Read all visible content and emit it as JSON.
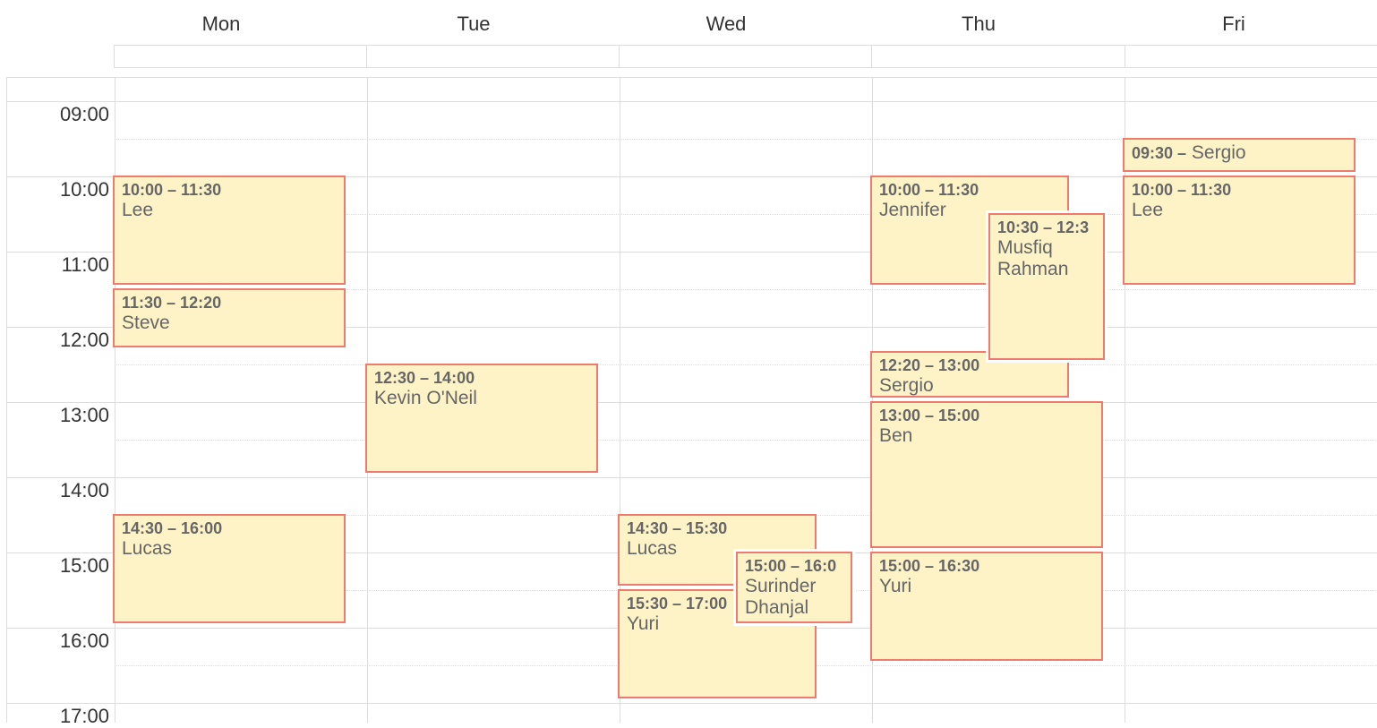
{
  "days": [
    "Mon",
    "Tue",
    "Wed",
    "Thu",
    "Fri"
  ],
  "times": [
    "09:00",
    "10:00",
    "11:00",
    "12:00",
    "13:00",
    "14:00",
    "15:00",
    "16:00",
    "17:00"
  ],
  "events": [
    {
      "day": "Mon",
      "time": "10:00 – 11:30",
      "title": "Lee"
    },
    {
      "day": "Mon",
      "time": "11:30 – 12:20",
      "title": "Steve"
    },
    {
      "day": "Mon",
      "time": "14:30 – 16:00",
      "title": "Lucas"
    },
    {
      "day": "Tue",
      "time": "12:30 – 14:00",
      "title": "Kevin O'Neil"
    },
    {
      "day": "Wed",
      "time": "14:30 – 15:30",
      "title": "Lucas"
    },
    {
      "day": "Wed",
      "time": "15:30 – 17:00",
      "title": "Yuri"
    },
    {
      "day": "Wed",
      "time": "15:00 – 16:0",
      "title": "Surinder Dhanjal"
    },
    {
      "day": "Thu",
      "time": "10:00 – 11:30",
      "title": "Jennifer"
    },
    {
      "day": "Thu",
      "time": "10:30 – 12:3",
      "title": "Musfiq Rahman"
    },
    {
      "day": "Thu",
      "time": "12:20 – 13:00",
      "title": "Sergio"
    },
    {
      "day": "Thu",
      "time": "13:00 – 15:00",
      "title": "Ben"
    },
    {
      "day": "Thu",
      "time": "15:00 – 16:30",
      "title": "Yuri"
    },
    {
      "day": "Fri",
      "time": "09:30 –",
      "title": "Sergio"
    },
    {
      "day": "Fri",
      "time": "10:00 – 11:30",
      "title": "Lee"
    }
  ]
}
